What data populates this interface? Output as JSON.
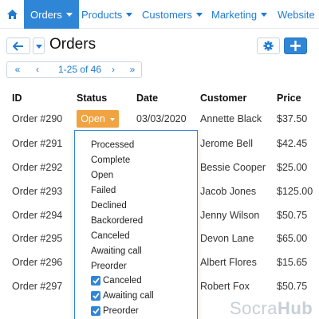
{
  "nav": {
    "home_icon": "home-icon",
    "items": [
      {
        "label": "Orders",
        "active": true
      },
      {
        "label": "Products"
      },
      {
        "label": "Customers"
      },
      {
        "label": "Marketing"
      },
      {
        "label": "Website"
      }
    ]
  },
  "header": {
    "title": "Orders",
    "back_icon": "arrow-left-icon",
    "settings_icon": "gear-icon",
    "add_icon": "plus-icon"
  },
  "pager": {
    "first": "«",
    "prev": "‹",
    "range": "1-25 of 46",
    "next": "›",
    "last": "»"
  },
  "table": {
    "columns": [
      "ID",
      "Status",
      "Date",
      "Customer",
      "Price"
    ],
    "rows": [
      {
        "id": "Order #290",
        "status": "Open",
        "date": "03/03/2020",
        "customer": "Annette Black",
        "price": "$37.50"
      },
      {
        "id": "Order #291",
        "customer": "Jerome Bell",
        "price": "$42.45"
      },
      {
        "id": "Order #292",
        "customer": "Bessie Cooper",
        "price": "$25.00"
      },
      {
        "id": "Order #293",
        "customer": "Jacob Jones",
        "price": "$125.00"
      },
      {
        "id": "Order #294",
        "customer": "Jenny Wilson",
        "price": "$50.75"
      },
      {
        "id": "Order #295",
        "customer": "Devon Lane",
        "price": "$65.00"
      },
      {
        "id": "Order #296",
        "customer": "Albert Flores",
        "price": "$15.65"
      },
      {
        "id": "Order #297",
        "customer": "Robert Fox",
        "price": "$50.75"
      }
    ]
  },
  "status_dropdown": {
    "options": [
      "Processed",
      "Complete",
      "Open",
      "Failed",
      "Declined",
      "Backordered",
      "Canceled",
      "Awaiting call",
      "Preorder"
    ],
    "checked": [
      "Canceled",
      "Awaiting call",
      "Preorder"
    ]
  },
  "watermark": {
    "part1": "Socra",
    "part2": "Hub"
  },
  "colors": {
    "accent": "#2f86d6",
    "status_open": "#f0a340"
  }
}
